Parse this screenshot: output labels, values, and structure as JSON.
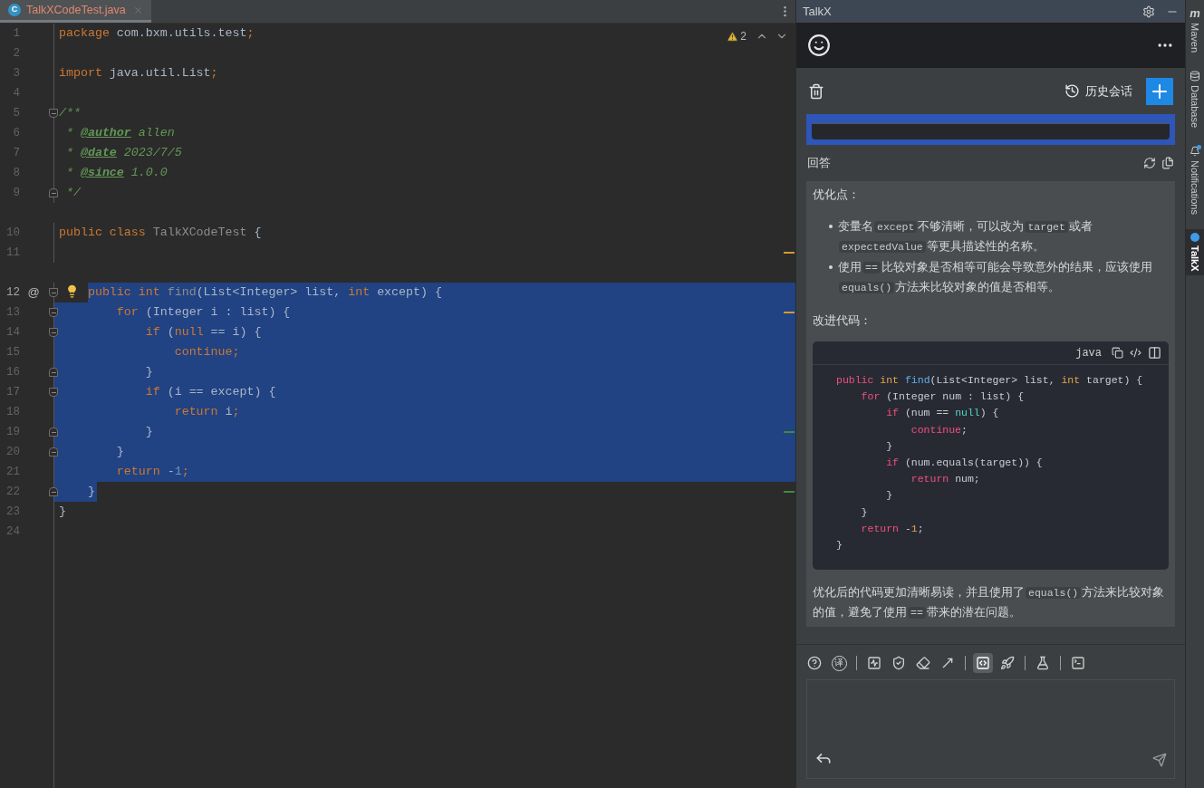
{
  "editor": {
    "tab": {
      "icon_letter": "C",
      "label": "TalkXCodeTest.java",
      "selected": true
    },
    "inspections": {
      "count": "2"
    },
    "lines": [
      {
        "number": "1",
        "tokens": [
          {
            "kind": "kw",
            "t": "package"
          },
          {
            "kind": "plain",
            "t": " com.bxm.utils.test"
          },
          {
            "kind": "kw",
            "t": ";"
          }
        ]
      },
      {
        "number": "2"
      },
      {
        "number": "3",
        "tokens": [
          {
            "kind": "kw",
            "t": "import"
          },
          {
            "kind": "plain",
            "t": " java.util.List"
          },
          {
            "kind": "kw",
            "t": ";"
          }
        ]
      },
      {
        "number": "4"
      },
      {
        "number": "5",
        "fold_start": true,
        "tokens": [
          {
            "kind": "cmt",
            "t": "/**"
          }
        ]
      },
      {
        "number": "6",
        "tokens": [
          {
            "kind": "cmt",
            "t": " * "
          },
          {
            "kind": "tag",
            "t": "@author"
          },
          {
            "kind": "cmt",
            "t": " allen"
          }
        ]
      },
      {
        "number": "7",
        "tokens": [
          {
            "kind": "cmt",
            "t": " * "
          },
          {
            "kind": "tag",
            "t": "@date"
          },
          {
            "kind": "cmt",
            "t": " 2023/7/5"
          }
        ]
      },
      {
        "number": "8",
        "tokens": [
          {
            "kind": "cmt",
            "t": " * "
          },
          {
            "kind": "tag",
            "t": "@since"
          },
          {
            "kind": "cmt",
            "t": " 1.0.0"
          }
        ]
      },
      {
        "number": "9",
        "fold_end": true,
        "tokens": [
          {
            "kind": "cmt",
            "t": " */"
          }
        ]
      },
      {
        "number": "10",
        "spaced": true,
        "tokens": [
          {
            "kind": "kw",
            "t": "public class "
          },
          {
            "kind": "unused",
            "t": "TalkXCodeTest"
          },
          {
            "kind": "plain",
            "t": " {"
          }
        ]
      },
      {
        "number": "11",
        "warning_mark": true
      },
      {
        "number": "12",
        "spaced": true,
        "gutter_mark": "@",
        "bulb": true,
        "fold_start": true,
        "selected": true,
        "selection_starts_at_text": true,
        "tokens": [
          {
            "kind": "kw",
            "t": "    public int "
          },
          {
            "kind": "unused",
            "t": "find"
          },
          {
            "kind": "plain",
            "t": "(List<Integer> list, "
          },
          {
            "kind": "kw",
            "t": "int"
          },
          {
            "kind": "plain",
            "t": " except) {"
          }
        ]
      },
      {
        "number": "13",
        "fold_start": true,
        "selected": true,
        "warning_mark": true,
        "tokens": [
          {
            "kind": "kw",
            "t": "        for"
          },
          {
            "kind": "plain",
            "t": " (Integer i : list) {"
          }
        ]
      },
      {
        "number": "14",
        "fold_start": true,
        "selected": true,
        "tokens": [
          {
            "kind": "kw",
            "t": "            if"
          },
          {
            "kind": "plain",
            "t": " ("
          },
          {
            "kind": "kw",
            "t": "null"
          },
          {
            "kind": "plain",
            "t": " == i) {"
          }
        ]
      },
      {
        "number": "15",
        "selected": true,
        "tokens": [
          {
            "kind": "kw",
            "t": "                continue;"
          }
        ]
      },
      {
        "number": "16",
        "fold_end": true,
        "selected": true,
        "tokens": [
          {
            "kind": "plain",
            "t": "            }"
          }
        ]
      },
      {
        "number": "17",
        "fold_start": true,
        "selected": true,
        "tokens": [
          {
            "kind": "kw",
            "t": "            if"
          },
          {
            "kind": "plain",
            "t": " (i == except) {"
          }
        ]
      },
      {
        "number": "18",
        "selected": true,
        "tokens": [
          {
            "kind": "kw",
            "t": "                return"
          },
          {
            "kind": "plain",
            "t": " i"
          },
          {
            "kind": "kw",
            "t": ";"
          }
        ]
      },
      {
        "number": "19",
        "fold_end": true,
        "selected": true,
        "change_mark": true,
        "tokens": [
          {
            "kind": "plain",
            "t": "            }"
          }
        ]
      },
      {
        "number": "20",
        "fold_end": true,
        "selected": true,
        "tokens": [
          {
            "kind": "plain",
            "t": "        }"
          }
        ]
      },
      {
        "number": "21",
        "selected": true,
        "tokens": [
          {
            "kind": "kw",
            "t": "        return"
          },
          {
            "kind": "plain",
            "t": " -"
          },
          {
            "kind": "num",
            "t": "1"
          },
          {
            "kind": "kw",
            "t": ";"
          }
        ]
      },
      {
        "number": "22",
        "fold_end": true,
        "selected": true,
        "selection_ends_at_text": true,
        "change_mark": true,
        "tokens": [
          {
            "kind": "plain",
            "t": "    }"
          }
        ]
      },
      {
        "number": "23",
        "tokens": [
          {
            "kind": "plain",
            "t": "}"
          }
        ]
      },
      {
        "number": "24"
      }
    ]
  },
  "talkx": {
    "title": "TalkX",
    "history_label": "历史会话",
    "answer_label": "回答",
    "answer": {
      "heading": "优化点：",
      "bullets": [
        [
          {
            "kind": "text",
            "t": "变量名"
          },
          {
            "kind": "code",
            "t": "except"
          },
          {
            "kind": "text",
            "t": "不够清晰，可以改为"
          },
          {
            "kind": "code",
            "t": "target"
          },
          {
            "kind": "text",
            "t": "或者"
          },
          {
            "kind": "code",
            "t": "expectedValue"
          },
          {
            "kind": "text",
            "t": "等更具描述性的名称。"
          }
        ],
        [
          {
            "kind": "text",
            "t": "使用"
          },
          {
            "kind": "code",
            "t": "=="
          },
          {
            "kind": "text",
            "t": "比较对象是否相等可能会导致意外的结果，应该使用"
          },
          {
            "kind": "code",
            "t": "equals()"
          },
          {
            "kind": "text",
            "t": "方法来比较对象的值是否相等。"
          }
        ]
      ],
      "code_heading": "改进代码：",
      "code_block": {
        "language": "java",
        "lines": [
          [
            {
              "kind": "kw",
              "t": "public "
            },
            {
              "kind": "type",
              "t": "int "
            },
            {
              "kind": "fn",
              "t": "find"
            },
            {
              "kind": "plain",
              "t": "(List<Integer> list, "
            },
            {
              "kind": "type",
              "t": "int"
            },
            {
              "kind": "plain",
              "t": " target) {"
            }
          ],
          [
            {
              "kind": "kw",
              "t": "    for"
            },
            {
              "kind": "plain",
              "t": " (Integer num : list) {"
            }
          ],
          [
            {
              "kind": "kw",
              "t": "        if"
            },
            {
              "kind": "plain",
              "t": " (num == "
            },
            {
              "kind": "lit",
              "t": "null"
            },
            {
              "kind": "plain",
              "t": ") {"
            }
          ],
          [
            {
              "kind": "kw",
              "t": "            continue"
            },
            {
              "kind": "plain",
              "t": ";"
            }
          ],
          [
            {
              "kind": "plain",
              "t": "        }"
            }
          ],
          [
            {
              "kind": "kw",
              "t": "        if"
            },
            {
              "kind": "plain",
              "t": " (num.equals(target)) {"
            }
          ],
          [
            {
              "kind": "kw",
              "t": "            return"
            },
            {
              "kind": "plain",
              "t": " num;"
            }
          ],
          [
            {
              "kind": "plain",
              "t": "        }"
            }
          ],
          [
            {
              "kind": "plain",
              "t": "    }"
            }
          ],
          [
            {
              "kind": "kw",
              "t": "    return"
            },
            {
              "kind": "plain",
              "t": " -"
            },
            {
              "kind": "num",
              "t": "1"
            },
            {
              "kind": "plain",
              "t": ";"
            }
          ],
          [
            {
              "kind": "plain",
              "t": "}"
            }
          ]
        ]
      },
      "closing": [
        {
          "kind": "text",
          "t": "优化后的代码更加清晰易读，并且使用了"
        },
        {
          "kind": "code",
          "t": "equals()"
        },
        {
          "kind": "text",
          "t": "方法来比较对象的值，避免了使用"
        },
        {
          "kind": "code",
          "t": "=="
        },
        {
          "kind": "text",
          "t": "带来的潜在问题。"
        }
      ]
    },
    "tools": [
      {
        "kind": "icon",
        "selected": false
      },
      {
        "kind": "letter",
        "t": "译",
        "selected": false
      },
      {
        "kind": "separator"
      },
      {
        "kind": "icon",
        "selected": false
      },
      {
        "kind": "icon",
        "selected": false
      },
      {
        "kind": "icon",
        "selected": false
      },
      {
        "kind": "icon",
        "selected": false
      },
      {
        "kind": "separator"
      },
      {
        "kind": "icon",
        "selected": true
      },
      {
        "kind": "icon",
        "selected": false
      },
      {
        "kind": "separator"
      },
      {
        "kind": "icon",
        "selected": false
      },
      {
        "kind": "separator"
      },
      {
        "kind": "icon",
        "selected": false
      }
    ]
  },
  "side_strip": [
    {
      "label": "Maven",
      "icon_letter": "m",
      "selected": false
    },
    {
      "label": "Database",
      "selected": false
    },
    {
      "label": "Notifications",
      "selected": false
    },
    {
      "label": "TalkX",
      "selected": true
    }
  ]
}
